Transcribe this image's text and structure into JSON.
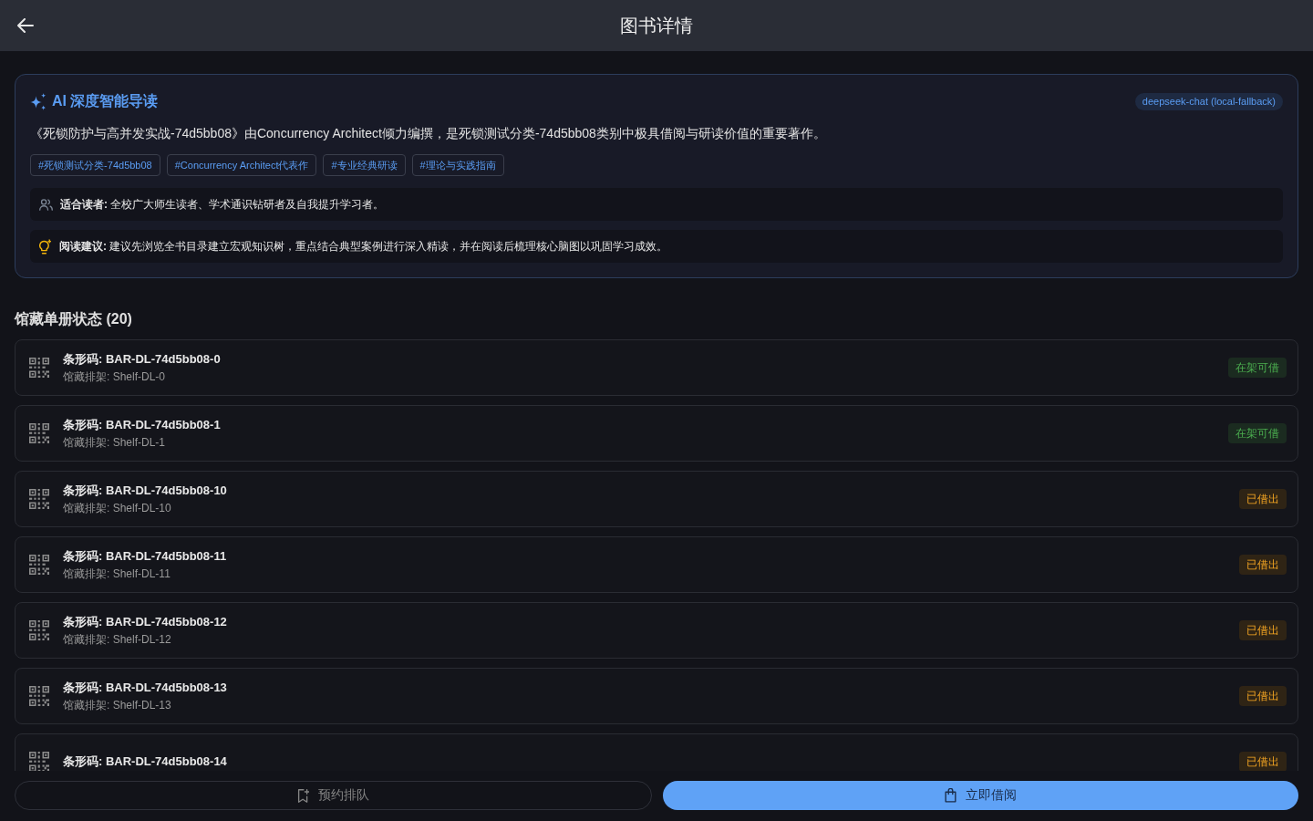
{
  "header": {
    "title": "图书详情"
  },
  "ai_guide": {
    "title": "AI 深度智能导读",
    "model": "deepseek-chat (local-fallback)",
    "summary": "《死锁防护与高并发实战-74d5bb08》由Concurrency Architect倾力编撰，是死锁测试分类-74d5bb08类别中极具借阅与研读价值的重要著作。",
    "tags": [
      "#死锁测试分类-74d5bb08",
      "#Concurrency Architect代表作",
      "#专业经典研读",
      "#理论与实践指南"
    ],
    "tips": [
      {
        "kind": "audience",
        "text": "**适合读者:** 全校广大师生读者、学术通识钻研者及自我提升学习者。"
      },
      {
        "kind": "suggestion",
        "text": "**阅读建议:** 建议先浏览全书目录建立宏观知识树，重点结合典型案例进行深入精读，并在阅读后梳理核心脑图以巩固学习成效。"
      }
    ]
  },
  "copies_section": {
    "title": "馆藏单册状态 (20)"
  },
  "copies": [
    {
      "barcode": "条形码: BAR-DL-74d5bb08-0",
      "shelf": "馆藏排架: Shelf-DL-0",
      "status": "在架可借",
      "kind": "available"
    },
    {
      "barcode": "条形码: BAR-DL-74d5bb08-1",
      "shelf": "馆藏排架: Shelf-DL-1",
      "status": "在架可借",
      "kind": "available"
    },
    {
      "barcode": "条形码: BAR-DL-74d5bb08-10",
      "shelf": "馆藏排架: Shelf-DL-10",
      "status": "已借出",
      "kind": "borrowed"
    },
    {
      "barcode": "条形码: BAR-DL-74d5bb08-11",
      "shelf": "馆藏排架: Shelf-DL-11",
      "status": "已借出",
      "kind": "borrowed"
    },
    {
      "barcode": "条形码: BAR-DL-74d5bb08-12",
      "shelf": "馆藏排架: Shelf-DL-12",
      "status": "已借出",
      "kind": "borrowed"
    },
    {
      "barcode": "条形码: BAR-DL-74d5bb08-13",
      "shelf": "馆藏排架: Shelf-DL-13",
      "status": "已借出",
      "kind": "borrowed"
    },
    {
      "barcode": "条形码: BAR-DL-74d5bb08-14",
      "status": "已借出",
      "kind": "borrowed"
    }
  ],
  "actions": {
    "reserve": {
      "label": "预约排队",
      "disabled": true
    },
    "borrow": {
      "label": "立即借阅",
      "disabled": false
    }
  }
}
